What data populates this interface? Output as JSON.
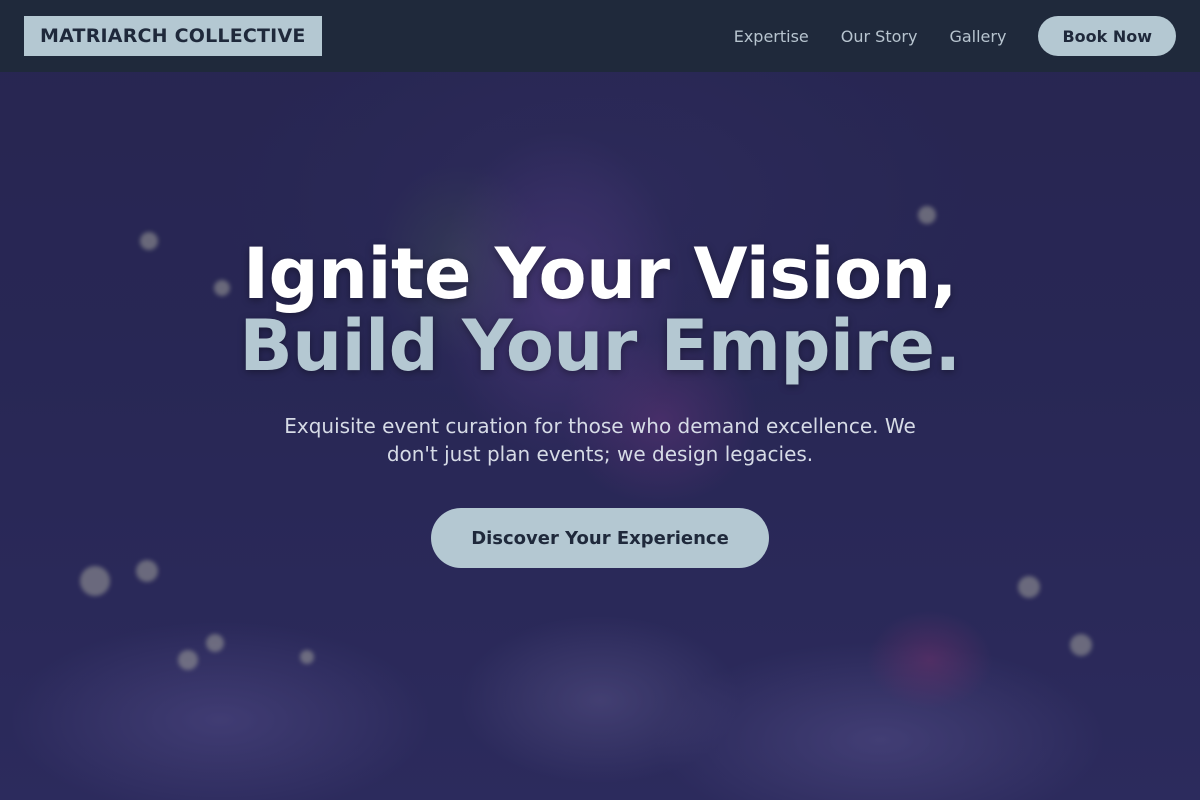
{
  "brand": {
    "name": "MATRIARCH COLLECTIVE"
  },
  "nav": {
    "links": [
      {
        "label": "Expertise"
      },
      {
        "label": "Our Story"
      },
      {
        "label": "Gallery"
      }
    ],
    "book_label": "Book Now"
  },
  "hero": {
    "headline_line1": "Ignite Your Vision,",
    "headline_line2": "Build Your Empire.",
    "subtitle": "Exquisite event curation for those who demand excellence. We don't just plan events; we design legacies.",
    "cta_label": "Discover Your Experience",
    "background_image": "blurred-floral-centerpiece-table-setting"
  },
  "colors": {
    "header_bg": "#1f293b",
    "accent": "#b4c8d2",
    "hero_overlay": "#2d2b58",
    "headline_primary": "#ffffff"
  }
}
